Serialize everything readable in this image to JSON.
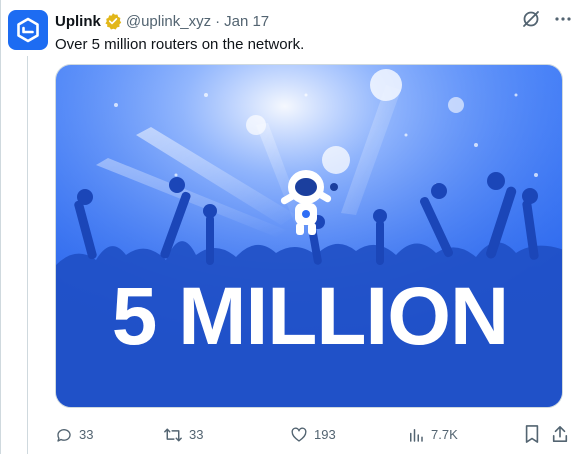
{
  "tweet": {
    "author_name": "Uplink",
    "handle": "@uplink_xyz",
    "separator": "·",
    "date": "Jan 17",
    "text": "Over 5 million routers on the network.",
    "media_headline": "5 MILLION"
  },
  "actions": {
    "replies": "33",
    "reposts": "33",
    "likes": "193",
    "views": "7.7K"
  },
  "colors": {
    "brand": "#1d6cf2",
    "verified": "#e2b719",
    "media_bg": "#2f6ef5"
  },
  "icons": [
    "uplink-logo-icon",
    "verified-badge-icon",
    "grok-icon",
    "more-icon",
    "reply-icon",
    "repost-icon",
    "like-icon",
    "views-icon",
    "bookmark-icon",
    "share-icon"
  ]
}
